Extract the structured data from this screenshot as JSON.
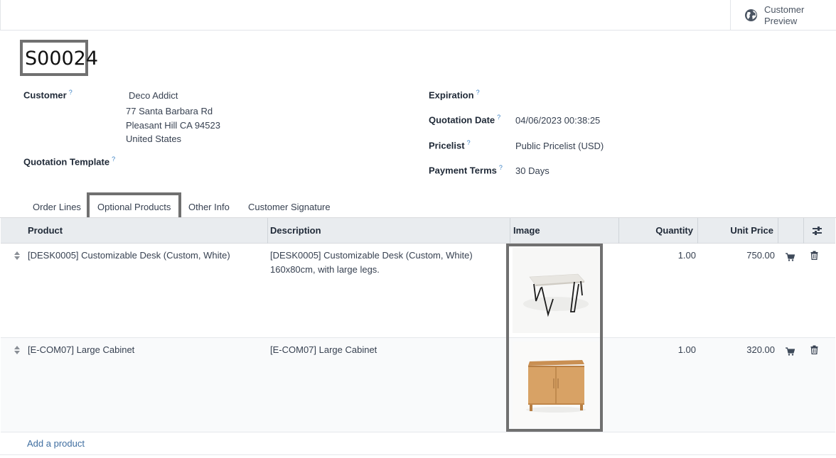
{
  "topbar": {
    "preview_label": "Customer Preview"
  },
  "record": {
    "name": "S00024"
  },
  "fields": {
    "customer": {
      "label": "Customer",
      "help": "?",
      "name": "Deco Addict",
      "address1": "77 Santa Barbara Rd",
      "address2": "Pleasant Hill CA 94523",
      "address3": "United States"
    },
    "quotation_template": {
      "label": "Quotation Template",
      "help": "?"
    },
    "expiration": {
      "label": "Expiration",
      "help": "?"
    },
    "quotation_date": {
      "label": "Quotation Date",
      "help": "?",
      "value": "04/06/2023 00:38:25"
    },
    "pricelist": {
      "label": "Pricelist",
      "help": "?",
      "value": "Public Pricelist (USD)"
    },
    "payment_terms": {
      "label": "Payment Terms",
      "help": "?",
      "value": "30 Days"
    }
  },
  "tabs": [
    {
      "label": "Order Lines"
    },
    {
      "label": "Optional Products",
      "active": true
    },
    {
      "label": "Other Info"
    },
    {
      "label": "Customer Signature"
    }
  ],
  "table": {
    "headers": {
      "product": "Product",
      "description": "Description",
      "image": "Image",
      "quantity": "Quantity",
      "unit_price": "Unit Price"
    },
    "rows": [
      {
        "product": "[DESK0005] Customizable Desk (Custom, White)",
        "description_line1": "[DESK0005] Customizable Desk (Custom, White)",
        "description_line2": "160x80cm, with large legs.",
        "image_icon": "desk-image",
        "quantity": "1.00",
        "unit_price": "750.00"
      },
      {
        "product": "[E-COM07] Large Cabinet",
        "description_line1": "[E-COM07] Large Cabinet",
        "description_line2": "",
        "image_icon": "cabinet-image",
        "quantity": "1.00",
        "unit_price": "320.00"
      }
    ],
    "add_label": "Add a product"
  },
  "colors": {
    "accent": "#714b67",
    "link": "#3f6ea0",
    "header_bg": "#e9ecef",
    "highlight_border": "#707070"
  }
}
